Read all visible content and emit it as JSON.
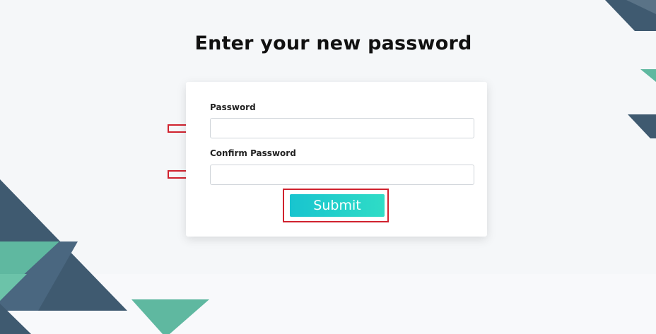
{
  "page": {
    "title": "Enter your new password"
  },
  "form": {
    "password": {
      "label": "Password",
      "value": "",
      "placeholder": ""
    },
    "confirm_password": {
      "label": "Confirm Password",
      "value": "",
      "placeholder": ""
    },
    "submit_label": "Submit"
  },
  "annotations": {
    "arrow_color": "#d0222e",
    "highlight_color": "#d0222e"
  },
  "colors": {
    "accent_start": "#18c4cf",
    "accent_end": "#2fdcc6",
    "deco_dark": "#3f5a70",
    "deco_teal": "#5fb8a0"
  }
}
